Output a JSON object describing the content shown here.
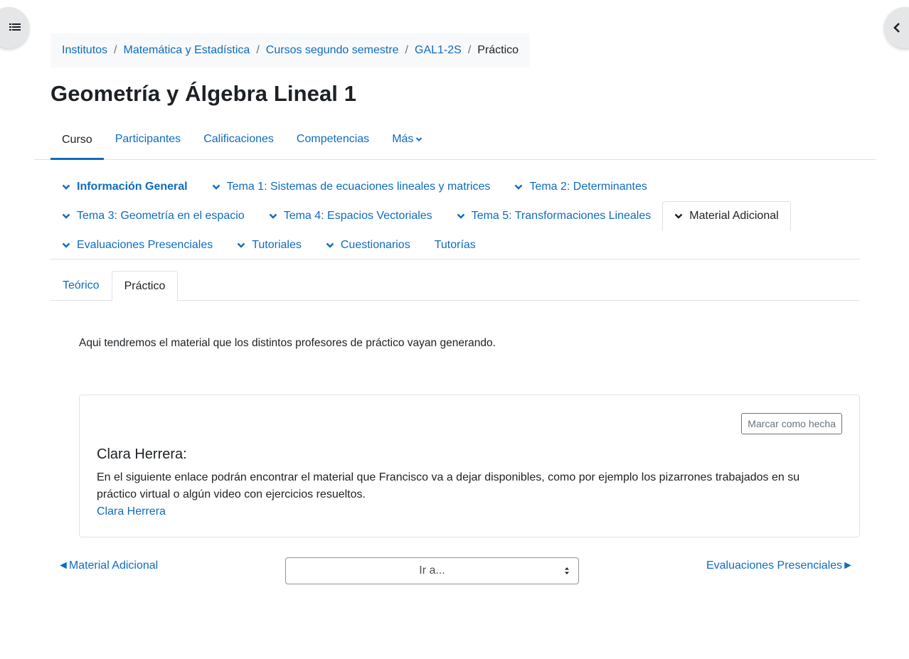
{
  "breadcrumb": {
    "items": [
      "Institutos",
      "Matemática y Estadística",
      "Cursos segundo semestre",
      "GAL1-2S"
    ],
    "current": "Práctico",
    "separator": "/"
  },
  "page": {
    "title": "Geometría y Álgebra Lineal 1"
  },
  "secondary_nav": {
    "items": [
      "Curso",
      "Participantes",
      "Calificaciones",
      "Competencias",
      "Más"
    ],
    "active": "Curso"
  },
  "sections": {
    "items": [
      "Información General",
      "Tema 1: Sistemas de ecuaciones lineales y matrices",
      "Tema 2: Determinantes",
      "Tema 3: Geometría en el espacio",
      "Tema 4: Espacios Vectoriales",
      "Tema 5: Transformaciones Lineales",
      "Material Adicional",
      "Evaluaciones Presenciales",
      "Tutoriales",
      "Cuestionarios",
      "Tutorías"
    ],
    "active": "Material Adicional"
  },
  "subsections": {
    "items": [
      "Teórico",
      "Práctico"
    ],
    "active": "Práctico"
  },
  "summary": "Aqui tendremos el material que los distintos profesores de práctico vayan generando.",
  "activity": {
    "mark_button": "Marcar como hecha",
    "title": "Clara Herrera:",
    "text": "En el siguiente enlace podrán encontrar el material que Francisco va a dejar disponibles, como por ejemplo los pizarrones trabajados en su práctico virtual o algún video con ejercicios resueltos.",
    "link": "Clara Herrera"
  },
  "footer_nav": {
    "prev": "◄Material Adicional",
    "jump_placeholder": "Ir a...",
    "next": "Evaluaciones Presenciales►"
  },
  "colors": {
    "link": "#0f6cbf",
    "text": "#1d2125",
    "border": "#dee2e6"
  },
  "icons": {
    "left_drawer": "list-icon",
    "right_drawer": "chevron-left-icon"
  }
}
